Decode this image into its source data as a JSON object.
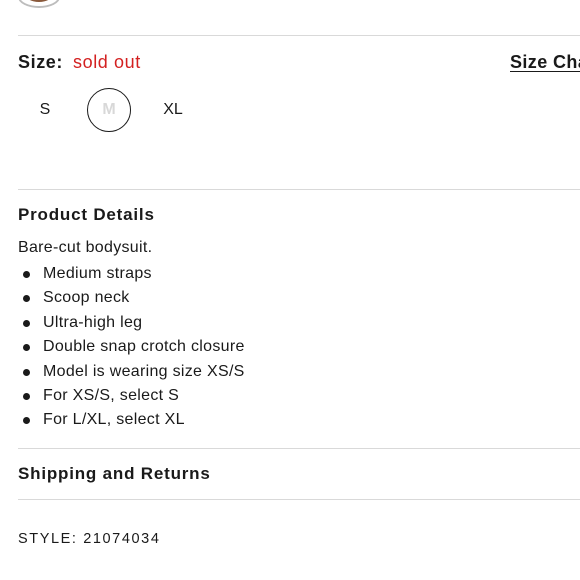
{
  "size": {
    "label": "Size:",
    "status": "sold out",
    "chart_link": "Size Chart",
    "options": [
      {
        "label": "S",
        "state": "available"
      },
      {
        "label": "M",
        "state": "selected-sold-out"
      },
      {
        "label": "XL",
        "state": "available"
      }
    ]
  },
  "product_details": {
    "title": "Product Details",
    "intro": "Bare-cut bodysuit.",
    "bullets": [
      "Medium straps",
      "Scoop neck",
      "Ultra-high leg",
      "Double snap crotch closure",
      "Model is wearing size XS/S",
      "For XS/S, select S",
      "For L/XL, select XL"
    ]
  },
  "shipping": {
    "title": "Shipping and Returns"
  },
  "style": {
    "text": "STYLE: 21074034"
  },
  "colors": {
    "sold_out_red": "#d32020",
    "divider": "#d9d9d9",
    "swatch_brown": "#8a5a3c"
  }
}
